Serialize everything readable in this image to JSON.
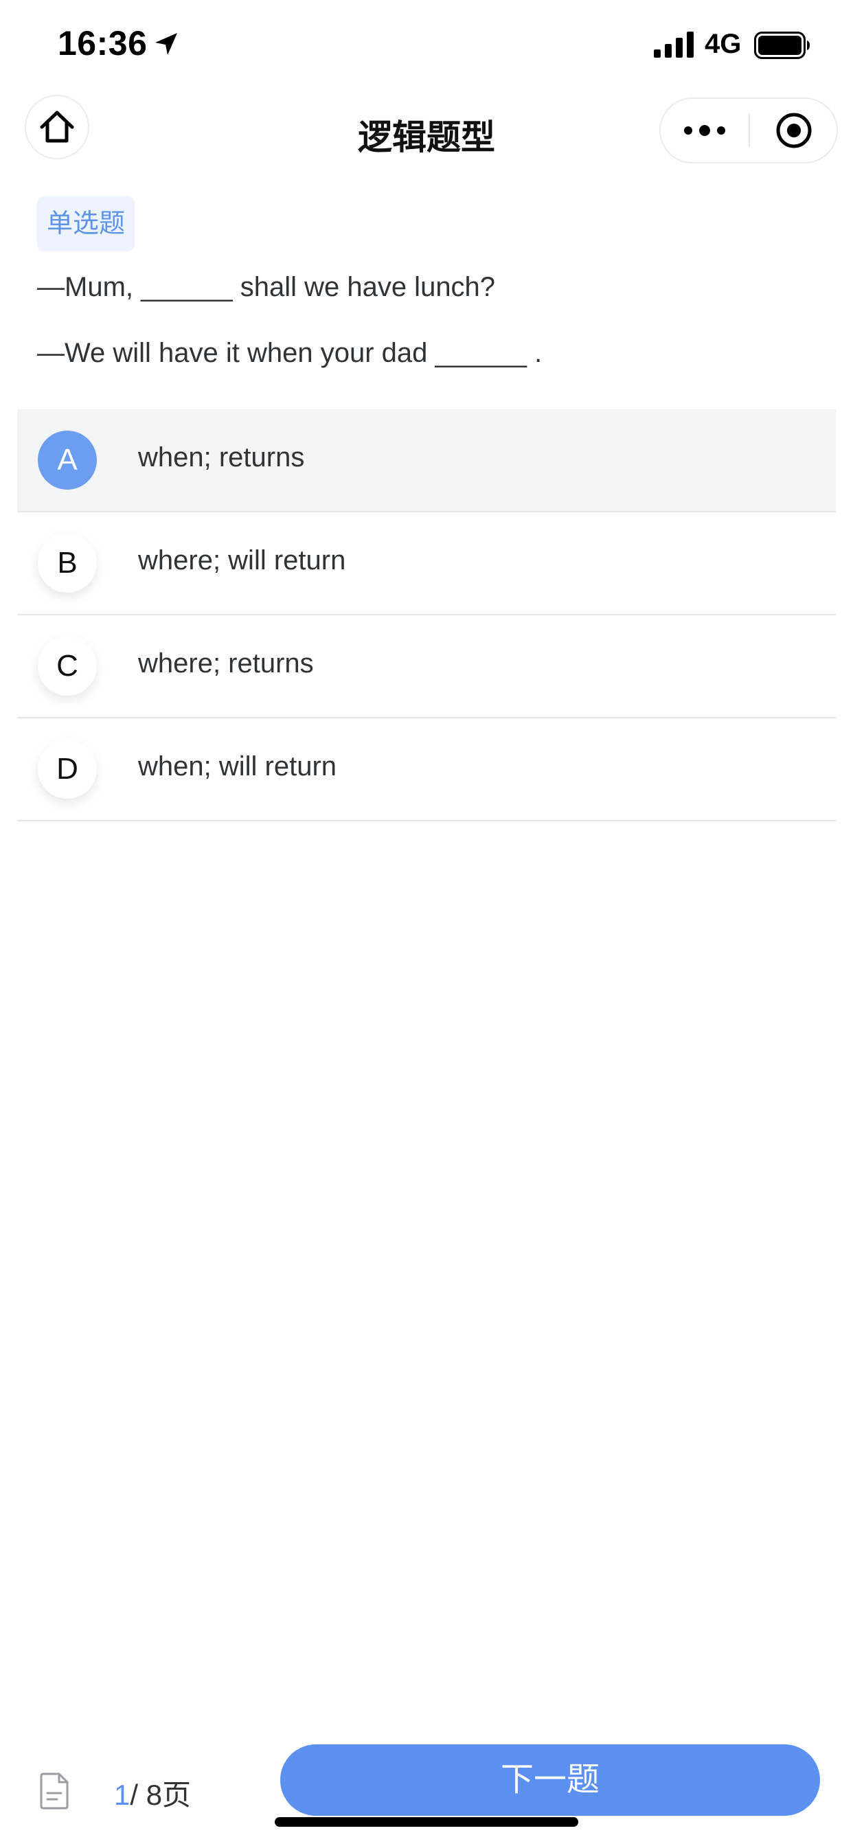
{
  "status_bar": {
    "time": "16:36",
    "network": "4G",
    "icons": [
      "location-arrow-icon",
      "signal-icon",
      "battery-icon"
    ]
  },
  "header": {
    "title": "逻辑题型",
    "icons": [
      "home-icon",
      "more-icon",
      "close-target-icon"
    ]
  },
  "question": {
    "type_label": "单选题",
    "lines": [
      "—Mum, ______ shall we have lunch?",
      "—We will have it when your dad ______ ."
    ]
  },
  "options": [
    {
      "letter": "A",
      "text": "when; returns",
      "selected": true
    },
    {
      "letter": "B",
      "text": "where; will return",
      "selected": false
    },
    {
      "letter": "C",
      "text": "where; returns",
      "selected": false
    },
    {
      "letter": "D",
      "text": "when; will return",
      "selected": false
    }
  ],
  "footer": {
    "current_page": "1",
    "total_pages": "/ 8页",
    "next_label": "下一题",
    "icons": [
      "document-icon"
    ]
  },
  "colors": {
    "accent": "#5b8ff0",
    "selected_letter_bg": "#6b9ef0",
    "badge_bg": "#ecf3fd",
    "badge_text": "#5d94ea",
    "selected_row_bg": "#f3f4f6"
  }
}
